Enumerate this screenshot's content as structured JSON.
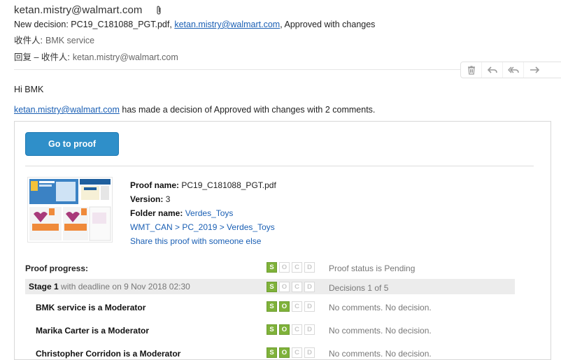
{
  "email": {
    "from": "ketan.mistry@walmart.com",
    "subject_prefix": "New decision: PC19_C181088_PGT.pdf, ",
    "subject_link": "ketan.mistry@walmart.com",
    "subject_suffix": ", Approved with changes",
    "to_label": "收件人:",
    "to_value": "BMK service",
    "reply_label": "回复 – 收件人:",
    "reply_value": "ketan.mistry@walmart.com"
  },
  "actions": {
    "icons": [
      "trash-icon",
      "reply-icon",
      "reply-all-icon",
      "forward-icon"
    ]
  },
  "body": {
    "greeting": "Hi BMK",
    "decision_link": "ketan.mistry@walmart.com",
    "decision_text": " has made a decision of Approved with changes with 2 comments."
  },
  "card": {
    "go_to_proof": "Go to proof",
    "proof_name_label": "Proof name:",
    "proof_name": "PC19_C181088_PGT.pdf",
    "version_label": "Version:",
    "version": "3",
    "folder_label": "Folder name:",
    "folder_name": "Verdes_Toys",
    "path": "WMT_CAN > PC_2019 > Verdes_Toys",
    "share": "Share this proof with someone else",
    "progress_label": "Proof progress:",
    "progress_status": "Proof status is Pending",
    "stage_name": "Stage 1",
    "stage_deadline": " with deadline on 9 Nov 2018 02:30",
    "stage_status": "Decisions 1 of 5",
    "moderators": [
      {
        "name": "BMK service is a Moderator",
        "status": "No comments. No decision."
      },
      {
        "name": "Marika Carter is a Moderator",
        "status": "No comments. No decision."
      },
      {
        "name": "Christopher Corridon is a Moderator",
        "status": "No comments. No decision."
      }
    ],
    "badge_letters": [
      "S",
      "O",
      "C",
      "D"
    ],
    "colors": {
      "accent": "#2f8fc9",
      "badge_on": "#7fb23a"
    }
  }
}
